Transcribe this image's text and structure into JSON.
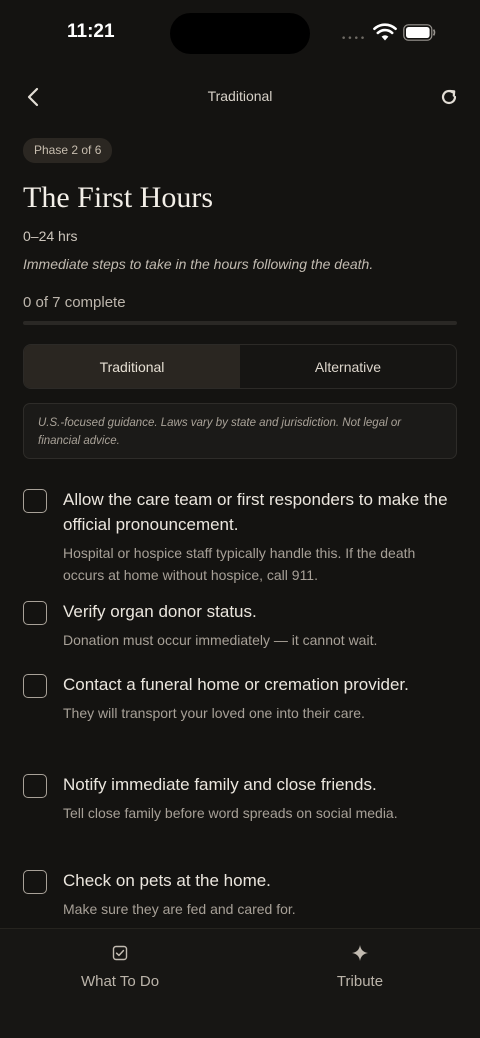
{
  "status_bar": {
    "time": "11:21",
    "signal": "••••"
  },
  "nav": {
    "title": "Traditional"
  },
  "phase": {
    "badge": "Phase 2 of 6",
    "title": "The First Hours",
    "time_range": "0–24 hrs",
    "description": "Immediate steps to take in the hours following the death."
  },
  "progress": {
    "label": "0 of 7 complete",
    "completed": 0,
    "total": 7
  },
  "tabs_mode": [
    {
      "label": "Traditional",
      "active": true
    },
    {
      "label": "Alternative",
      "active": false
    }
  ],
  "disclaimer": "U.S.-focused guidance. Laws vary by state and jurisdiction. Not legal or financial advice.",
  "checklist": [
    {
      "title": "Allow the care team or first responders to make the official pronouncement.",
      "detail": "Hospital or hospice staff typically handle this. If the death occurs at home without hospice, call 911.",
      "checked": false
    },
    {
      "title": "Verify organ donor status.",
      "detail": "Donation must occur immediately — it cannot wait.",
      "checked": false
    },
    {
      "title": "Contact a funeral home or cremation provider.",
      "detail": "They will transport your loved one into their care.",
      "checked": false
    },
    {
      "title": "Notify immediate family and close friends.",
      "detail": "Tell close family before word spreads on social media.",
      "checked": false
    },
    {
      "title": "Check on pets at the home.",
      "detail": "Make sure they are fed and cared for.",
      "checked": false
    }
  ],
  "tab_bar": {
    "what_to_do": {
      "label": "What To Do",
      "icon": "checkbox-icon"
    },
    "tribute": {
      "label": "Tribute",
      "icon": "sparkle-icon"
    }
  },
  "colors": {
    "background": "#141311",
    "accent": "#b89d74",
    "text": "#e9e4dc"
  }
}
